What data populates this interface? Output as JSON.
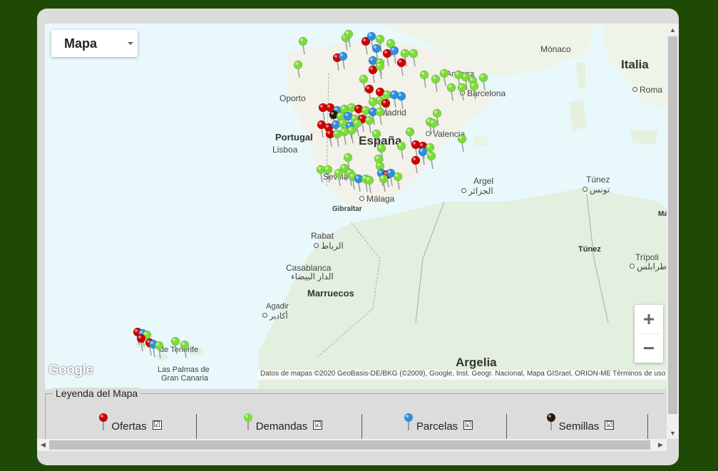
{
  "map": {
    "type_label": "Mapa",
    "places": {
      "monaco": "Mónaco",
      "italia": "Italia",
      "roma": "Roma",
      "andorra": "Andorra",
      "barcelona": "Barcelona",
      "oporto": "Oporto",
      "portugal": "Portugal",
      "lisboa": "Lisboa",
      "madrid": "Madrid",
      "espana": "España",
      "valencia": "Valencia",
      "sevilla": "Sevilla",
      "malaga": "Málaga",
      "gibraltar": "Gibraltar",
      "argel": "Argel",
      "argel_ar": "الجزائر",
      "tunez": "Túnez",
      "tunez_ar": "تونس",
      "tunez2": "Túnez",
      "rabat": "Rabat",
      "rabat_ar": "الرباط",
      "casablanca": "Casablanca",
      "casablanca_ar": "الدار البيضاء",
      "marruecos": "Marruecos",
      "agadir": "Agadir",
      "agadir_ar": "أكادير",
      "tripoli": "Trípoli",
      "tripoli_ar": "طرابلس",
      "tenerife": "de Tenerife",
      "laspalmas": "Las Palmas de",
      "grancanaria": "Gran Canaria",
      "argelia": "Argelia",
      "ma": "Ma"
    },
    "attribution": "Datos de mapas ©2020 GeoBasis-DE/BKG (©2009), Google, Inst. Geogr. Nacional, Mapa GISrael, ORION-ME",
    "terms": "Términos de uso",
    "google_logo": "Google",
    "zoom_in": "+",
    "zoom_out": "−"
  },
  "legend": {
    "title": "Leyenda del Mapa",
    "items": [
      {
        "label": "Ofertas",
        "color": "#cc0000",
        "checked": "☑"
      },
      {
        "label": "Demandas",
        "color": "#7ddc3c",
        "checked": "☑"
      },
      {
        "label": "Parcelas",
        "color": "#2e8ee0",
        "checked": "☑"
      },
      {
        "label": "Semillas",
        "color": "#2a1a0a",
        "checked": "☑"
      }
    ]
  },
  "scroll": {
    "up": "▲",
    "down": "▼",
    "left": "◀",
    "right": "▶"
  }
}
